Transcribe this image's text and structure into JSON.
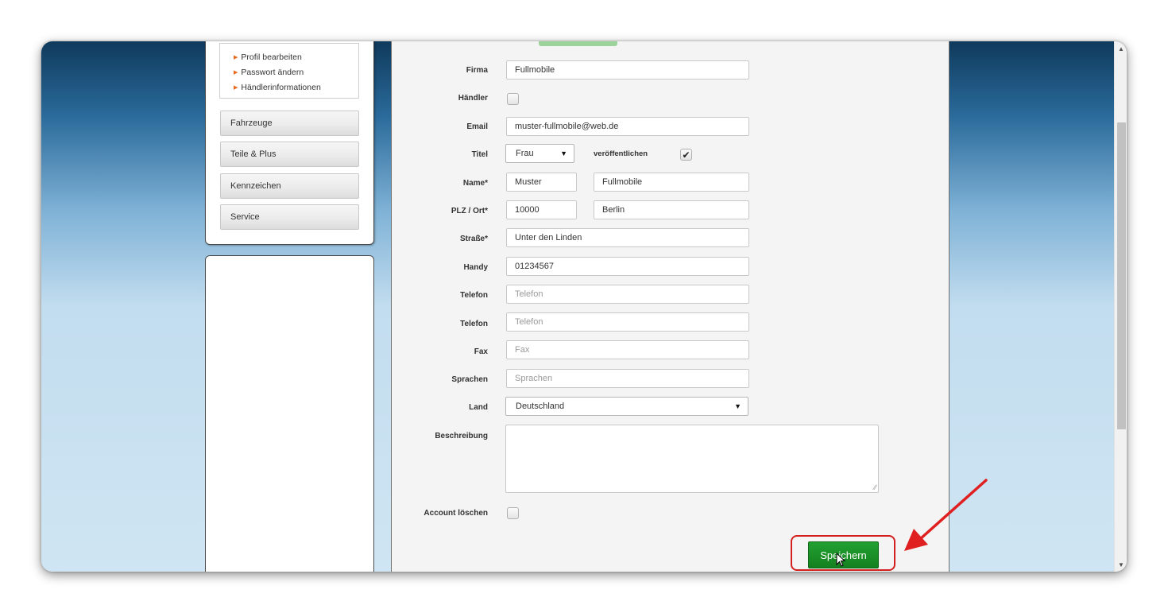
{
  "sidebar": {
    "profile_links": [
      "Profil bearbeiten",
      "Passwort ändern",
      "Händlerinformationen"
    ],
    "nav_items": [
      "Fahrzeuge",
      "Teile & Plus",
      "Kennzeichen",
      "Service"
    ]
  },
  "form": {
    "firma": {
      "label": "Firma",
      "value": "Fullmobile"
    },
    "haendler": {
      "label": "Händler",
      "checked": false
    },
    "email": {
      "label": "Email",
      "value": "muster-fullmobile@web.de"
    },
    "titel": {
      "label": "Titel",
      "value": "Frau",
      "publish_label": "veröffentlichen",
      "publish_checked": true
    },
    "name": {
      "label": "Name*",
      "first": "Muster",
      "last": "Fullmobile"
    },
    "plz_ort": {
      "label": "PLZ / Ort*",
      "plz": "10000",
      "ort": "Berlin"
    },
    "strasse": {
      "label": "Straße*",
      "value": "Unter den Linden"
    },
    "handy": {
      "label": "Handy",
      "value": "01234567"
    },
    "telefon1": {
      "label": "Telefon",
      "placeholder": "Telefon"
    },
    "telefon2": {
      "label": "Telefon",
      "placeholder": "Telefon"
    },
    "fax": {
      "label": "Fax",
      "placeholder": "Fax"
    },
    "sprachen": {
      "label": "Sprachen",
      "placeholder": "Sprachen"
    },
    "land": {
      "label": "Land",
      "value": "Deutschland"
    },
    "beschreibung": {
      "label": "Beschreibung",
      "value": ""
    },
    "account_loeschen": {
      "label": "Account löschen",
      "checked": false
    },
    "save_label": "Speichern"
  },
  "colors": {
    "save_button": "#1a8f27",
    "highlight": "#d41f1f",
    "link_arrow": "#e8681c"
  }
}
